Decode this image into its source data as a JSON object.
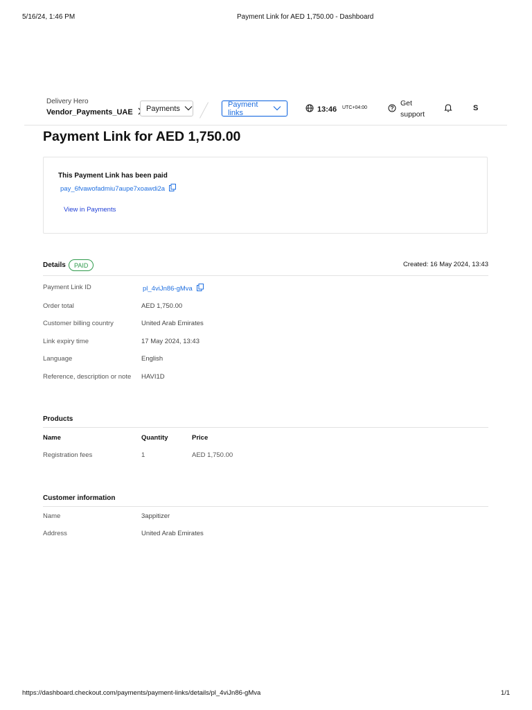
{
  "print_header": {
    "datetime": "5/16/24, 1:46 PM",
    "doc_title": "Payment Link for AED 1,750.00 - Dashboard"
  },
  "print_footer": {
    "url": "https://dashboard.checkout.com/payments/payment-links/details/pl_4viJn86-gMva",
    "page": "1/1"
  },
  "topnav": {
    "org_name": "Delivery Hero",
    "entity": "Vendor_Payments_UAE",
    "menu_payments": "Payments",
    "menu_payment_links": "Payment links",
    "time": "13:46",
    "timezone": "UTC+04:00",
    "support_line1": "Get",
    "support_line2": "support",
    "avatar_initial": "S"
  },
  "page": {
    "title": "Payment Link for AED 1,750.00"
  },
  "paid_notice": {
    "title": "This Payment Link has been paid",
    "payment_id": "pay_6fvawofadmiu7aupe7xoawdi2a",
    "view_link": "View in Payments"
  },
  "details": {
    "heading": "Details",
    "status_badge": "PAID",
    "created": "Created: 16 May 2024, 13:43",
    "rows": [
      {
        "label": "Payment Link ID",
        "value": "pl_4viJn86-gMva"
      },
      {
        "label": "Order total",
        "value": "AED 1,750.00"
      },
      {
        "label": "Customer billing country",
        "value": "United Arab Emirates"
      },
      {
        "label": "Link expiry time",
        "value": "17 May 2024, 13:43"
      },
      {
        "label": "Language",
        "value": "English"
      },
      {
        "label": "Reference, description or note",
        "value": "HAVI1D"
      }
    ]
  },
  "products": {
    "heading": "Products",
    "columns": [
      "Name",
      "Quantity",
      "Price"
    ],
    "rows": [
      {
        "name": "Registration fees",
        "quantity": "1",
        "price": "AED 1,750.00"
      }
    ]
  },
  "customer": {
    "heading": "Customer information",
    "rows": [
      {
        "label": "Name",
        "value": "3appitizer"
      },
      {
        "label": "Address",
        "value": "United Arab Emirates"
      }
    ]
  },
  "colors": {
    "link_blue": "#1f6fe0",
    "paid_green": "#2e9a4b"
  },
  "icons": [
    "chevron-right-icon",
    "chevron-down-icon",
    "globe-icon",
    "help-circle-icon",
    "bell-icon",
    "copy-icon"
  ]
}
